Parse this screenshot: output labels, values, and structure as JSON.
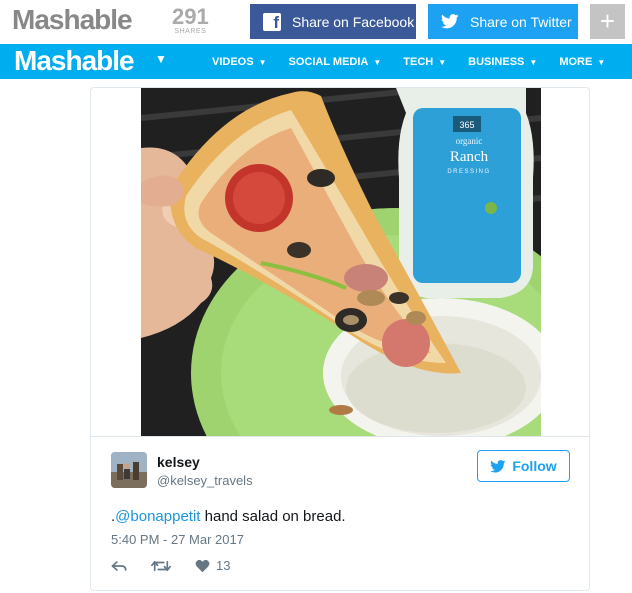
{
  "sharebar": {
    "logo": "Mashable",
    "share_count": "291",
    "share_count_label": "SHARES",
    "facebook_label": "Share on Facebook",
    "twitter_label": "Share on Twitter",
    "more_label": "+"
  },
  "navbar": {
    "logo": "Mashable",
    "items": [
      {
        "label": "VIDEOS"
      },
      {
        "label": "SOCIAL MEDIA"
      },
      {
        "label": "TECH"
      },
      {
        "label": "BUSINESS"
      },
      {
        "label": "MORE"
      }
    ]
  },
  "tweet": {
    "name": "kelsey",
    "handle": "@kelsey_travels",
    "follow_label": "Follow",
    "text_prefix": ".",
    "mention": "@bonappetit",
    "text_rest": " hand salad on bread.",
    "timestamp": "5:40 PM - 27 Mar 2017",
    "like_count": "13"
  },
  "bottle": {
    "brand": "365",
    "line1": "organic",
    "line2": "Ranch",
    "line3": "DRESSING"
  },
  "colors": {
    "brand_blue": "#00aeef",
    "facebook": "#3b5998",
    "twitter": "#1da1f2",
    "link": "#1b95e0"
  },
  "icons": [
    "facebook-icon",
    "twitter-bird-icon",
    "plus-icon",
    "caret-down-icon",
    "reply-icon",
    "retweet-icon",
    "heart-icon"
  ]
}
